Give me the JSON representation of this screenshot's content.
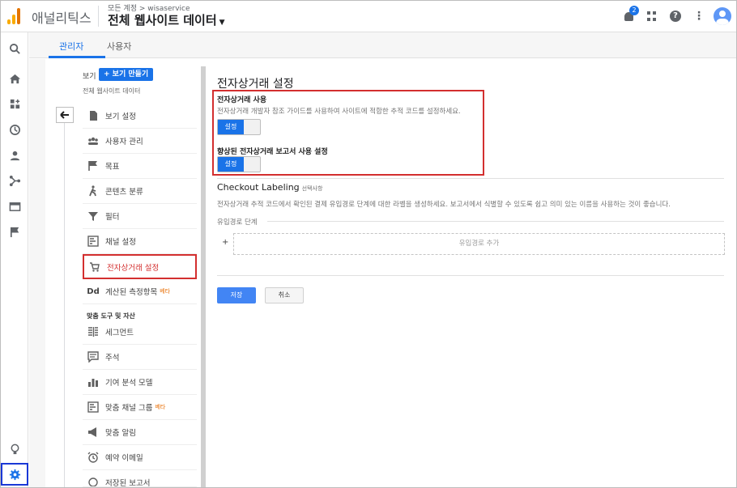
{
  "header": {
    "app_name": "애널리틱스",
    "account_path": "모든 계정 > wisaservice",
    "property_title": "전체 웹사이트 데이터",
    "notification_count": "2",
    "help_glyph": "?"
  },
  "rail": {
    "icons": [
      "search-icon",
      "home-icon",
      "customization-icon",
      "realtime-icon",
      "audience-icon",
      "acquisition-icon",
      "behavior-icon",
      "conversions-icon",
      "discover-icon",
      "admin-settings-icon"
    ]
  },
  "tabs": [
    {
      "label": "관리자",
      "active": true
    },
    {
      "label": "사용자",
      "active": false
    }
  ],
  "view_column": {
    "view_label": "보기",
    "new_view_button": "+ 보기 만들기",
    "view_name": "전체 웹사이트 데이터",
    "items": [
      {
        "label": "보기 설정",
        "icon": "document-icon"
      },
      {
        "label": "사용자 관리",
        "icon": "people-icon"
      },
      {
        "label": "목표",
        "icon": "flag-icon"
      },
      {
        "label": "콘텐츠 분류",
        "icon": "hiker-icon"
      },
      {
        "label": "필터",
        "icon": "filter-icon"
      },
      {
        "label": "채널 설정",
        "icon": "channel-icon"
      },
      {
        "label": "전자상거래 설정",
        "icon": "cart-icon",
        "active": true
      },
      {
        "label": "계산된 측정항목",
        "icon": "dd-icon",
        "beta": "베타"
      }
    ],
    "section_heading": "맞춤 도구 및 자산",
    "tool_items": [
      {
        "label": "세그먼트",
        "icon": "segment-icon"
      },
      {
        "label": "주석",
        "icon": "annotation-icon"
      },
      {
        "label": "기여 분석 모델",
        "icon": "bar-chart-icon"
      },
      {
        "label": "맞춤 채널 그룹",
        "icon": "channel-group-icon",
        "beta": "베타"
      },
      {
        "label": "맞춤 알림",
        "icon": "megaphone-icon"
      },
      {
        "label": "예약 이메일",
        "icon": "alarm-icon"
      },
      {
        "label": "저장된 보고서",
        "icon": "saved-report-icon"
      }
    ]
  },
  "main": {
    "title": "전자상거래 설정",
    "ecommerce": {
      "label": "전자상거래 사용",
      "description": "전자상거래 개발자 참조 가이드를 사용하여 사이트에 적합한 추적 코드를 설정하세요.",
      "toggle_label": "설정"
    },
    "enhanced": {
      "label": "향상된 전자상거래 보고서 사용 설정",
      "toggle_label": "설정"
    },
    "checkout": {
      "title": "Checkout Labeling",
      "optional": "선택사항",
      "description": "전자상거래 추적 코드에서 확인된 결제 유입경로 단계에 대한 라벨을 생성하세요. 보고서에서 식별할 수 있도록 쉽고 의미 있는 이름을 사용하는 것이 좋습니다.",
      "funnel_label": "유입경로 단계",
      "plus": "+",
      "add_step": "유입경로 추가"
    },
    "save_button": "저장",
    "cancel_button": "취소"
  },
  "colors": {
    "accent": "#1a73e8",
    "highlight_red": "#d32f2f",
    "highlight_blue": "#1a38d6"
  }
}
